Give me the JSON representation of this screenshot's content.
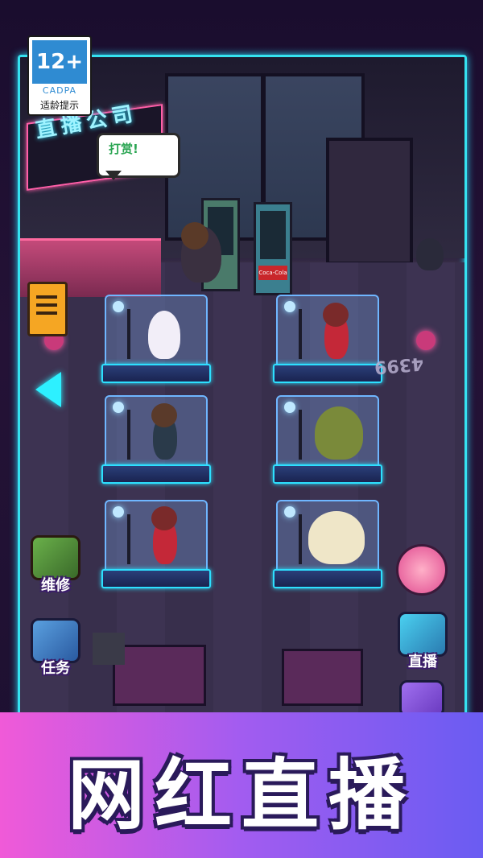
{
  "rating_badge": {
    "age": "12+",
    "org": "CADPA",
    "note": "适龄提示"
  },
  "shop_sign": "直播公司",
  "speech_bubble": "打赏!",
  "score_counter": "4399",
  "vending_label": "Coca-Cola",
  "side_buttons": {
    "repair": "维修",
    "tasks": "任务",
    "livestream": "直播"
  },
  "banner_title": "网红直播",
  "colors": {
    "neon_frame": "#35e2f0",
    "banner_left": "#f05ad8",
    "banner_right": "#6a5cf2",
    "accent_pink": "#ff5fa8"
  },
  "icons": [
    "document-icon",
    "back-arrow-icon",
    "repair-icon",
    "task-clipboard-icon",
    "tv-livestream-icon",
    "avatar-alert-icon",
    "money-icon"
  ]
}
